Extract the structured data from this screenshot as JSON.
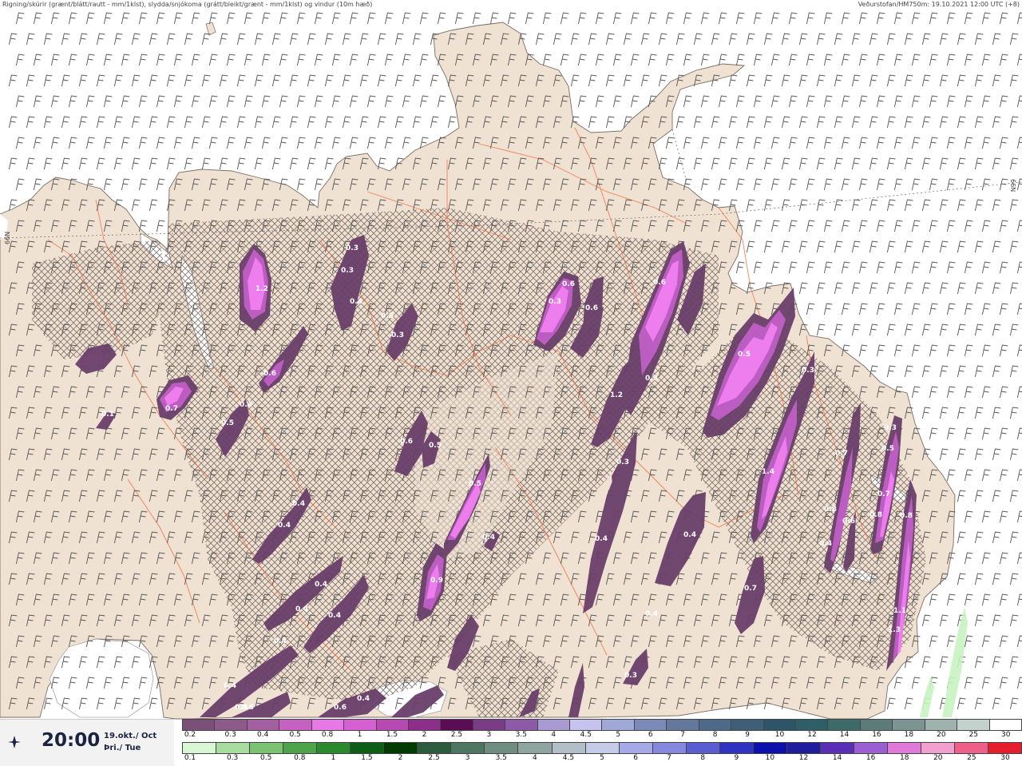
{
  "header": {
    "left": "Rigning/skúrir (grænt/blátt/rautt - mm/1klst), slydda/snjókoma (grátt/bleikt/grænt - mm/1klst) og vindur (10m hæð)",
    "right": "Veðurstofan/HM750m: 19.10.2021 12:00 UTC (+8)"
  },
  "time_box": {
    "time": "20:00",
    "date_line1": "19.okt./ Oct",
    "date_line2": "Þri./ Tue"
  },
  "latitude_labels": {
    "left": "66N",
    "right": "66N"
  },
  "precip_values": [
    "0.3",
    "0.3",
    "0.4",
    "1.2",
    "0.5",
    "0.1",
    "0.7",
    "0.6",
    "0.4",
    "0.5",
    "0.3",
    "0.6",
    "0.3",
    "0.6",
    "0.6",
    "0.3",
    "1.2",
    "0.5",
    "0.3",
    "1.4",
    "0.3",
    "0.5",
    "0.7",
    "0.7",
    "0.8",
    "0.8",
    "0.6",
    "1.1",
    "0.4",
    "1.3",
    "0.9",
    "0.4",
    "0.4",
    "0.4",
    "0.4",
    "0.4",
    "0.5",
    "0.6",
    "0.5",
    "0.4",
    "0.8",
    "0.4",
    "0.4",
    "0.7",
    "0.6",
    "0.4",
    "0.3",
    "0.4",
    "0.9",
    "0.6",
    "0.4",
    "0.3",
    "0.4"
  ],
  "scale_top": {
    "labels": [
      "0.2",
      "0.3",
      "0.4",
      "0.5",
      "0.8",
      "1",
      "1.5",
      "2",
      "2.5",
      "3",
      "3.5",
      "4",
      "4.5",
      "5",
      "6",
      "7",
      "8",
      "9",
      "10",
      "12",
      "14",
      "16",
      "18",
      "20",
      "25",
      "30"
    ],
    "colors": [
      "#7a4f78",
      "#8d5a8b",
      "#a35fa0",
      "#c561c2",
      "#e779e6",
      "#d65fd4",
      "#b64ab2",
      "#8d2f8a",
      "#5a0d55",
      "#7a3c85",
      "#8e5aa8",
      "#a99ad4",
      "#c6c3ee",
      "#a0a8d8",
      "#7b8ab8",
      "#64789e",
      "#4e6a8a",
      "#3f5f78",
      "#2e5468",
      "#2f5f66",
      "#3d6b6a",
      "#5b7c79",
      "#7c9592",
      "#9fb3ae",
      "#c3d2cd",
      "#ffffff"
    ]
  },
  "scale_bottom": {
    "labels": [
      "0.1",
      "0.3",
      "0.5",
      "0.8",
      "1",
      "1.5",
      "2",
      "2.5",
      "3",
      "3.5",
      "4",
      "4.5",
      "5",
      "6",
      "7",
      "8",
      "9",
      "10",
      "12",
      "14",
      "16",
      "18",
      "20",
      "25",
      "30"
    ],
    "colors": [
      "#d9f7d4",
      "#a8dca0",
      "#7cc273",
      "#4ea44a",
      "#2b8a2e",
      "#0f5e17",
      "#003b00",
      "#2d5c3d",
      "#4d7561",
      "#6f8d80",
      "#8fa6a0",
      "#b2bfc7",
      "#c6cbe8",
      "#a6a9e8",
      "#8588dc",
      "#5b5ed0",
      "#2e33c2",
      "#0c10ad",
      "#1f1d9b",
      "#5a2eb5",
      "#9a5fd0",
      "#e07ad8",
      "#f2a0cf",
      "#ee5f8a",
      "#e51d2c"
    ]
  },
  "colors": {
    "land": "#f0e2d3",
    "sea": "#ffffff",
    "snow_light": "#f4a8f6",
    "snow_mid": "#c15fc6",
    "snow_dark": "#6a3f6a",
    "rain_light": "#c8f3c0",
    "roads": "#f07040",
    "wind_barbs": "#555555"
  }
}
